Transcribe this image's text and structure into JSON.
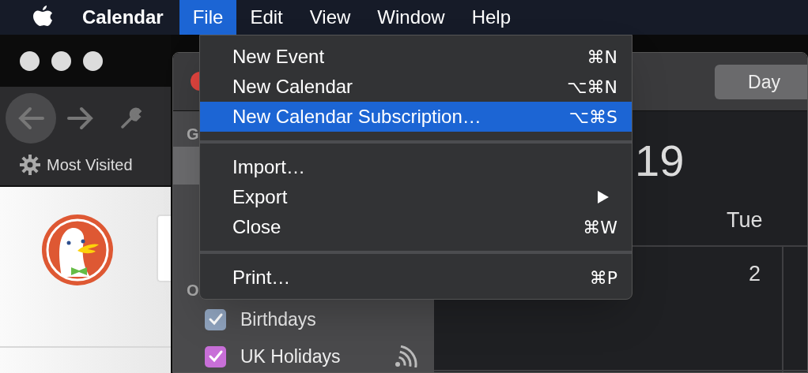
{
  "menu_bar": {
    "app_name": "Calendar",
    "menus": [
      {
        "label": "File",
        "selected": true
      },
      {
        "label": "Edit",
        "selected": false
      },
      {
        "label": "View",
        "selected": false
      },
      {
        "label": "Window",
        "selected": false
      },
      {
        "label": "Help",
        "selected": false
      }
    ]
  },
  "browser": {
    "bookmark": "Most Visited"
  },
  "calendar_window": {
    "view_button": {
      "label": "Day"
    },
    "sidebar": {
      "headings": [
        "G",
        "O"
      ],
      "calendars": [
        {
          "name": "Birthdays",
          "checked": true,
          "color": "#8fa3be",
          "subscribed": false
        },
        {
          "name": "UK Holidays",
          "checked": true,
          "color": "#c86fd8",
          "subscribed": true
        }
      ]
    },
    "year_fragment": "19",
    "day_header": "Tue",
    "date": "2"
  },
  "file_menu": [
    {
      "kind": "item",
      "label": "New Event",
      "shortcut": "⌘N",
      "submenu": false,
      "selected": false
    },
    {
      "kind": "item",
      "label": "New Calendar",
      "shortcut": "⌥⌘N",
      "submenu": false,
      "selected": false
    },
    {
      "kind": "item",
      "label": "New Calendar Subscription…",
      "shortcut": "⌥⌘S",
      "submenu": false,
      "selected": true
    },
    {
      "kind": "separator"
    },
    {
      "kind": "item",
      "label": "Import…",
      "submenu": false,
      "selected": false
    },
    {
      "kind": "item",
      "label": "Export",
      "submenu": true,
      "selected": false
    },
    {
      "kind": "item",
      "label": "Close",
      "shortcut": "⌘W",
      "submenu": false,
      "selected": false
    },
    {
      "kind": "separator"
    },
    {
      "kind": "item",
      "label": "Print…",
      "shortcut": "⌘P",
      "submenu": false,
      "selected": false
    }
  ]
}
